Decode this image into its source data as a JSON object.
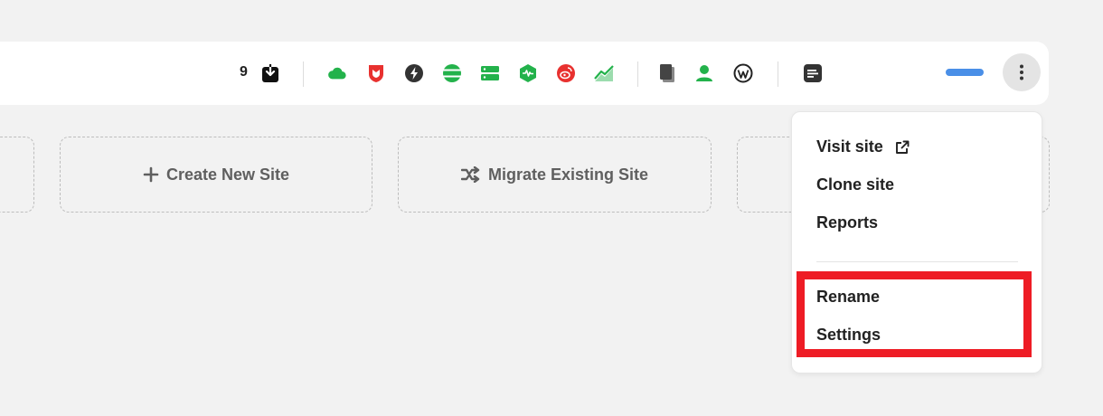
{
  "toolbar": {
    "download_count": "9",
    "icons": [
      "download-icon",
      "cloud-icon",
      "shield-icon",
      "lightning-icon",
      "database-icon",
      "server-icon",
      "activity-icon",
      "weibo-icon",
      "trend-chart-icon",
      "copy-icon",
      "user-icon",
      "wordpress-icon",
      "notes-icon",
      "more-vertical-icon"
    ],
    "accent_color": "#4a8fe7"
  },
  "cards": {
    "create_label": "Create New Site",
    "migrate_label": "Migrate Existing Site"
  },
  "menu": {
    "visit_site": "Visit site",
    "clone_site": "Clone site",
    "reports": "Reports",
    "rename": "Rename",
    "settings": "Settings"
  },
  "colors": {
    "green": "#23b24b",
    "red": "#e8312f",
    "highlight": "#ee1c25",
    "dark": "#333333"
  }
}
